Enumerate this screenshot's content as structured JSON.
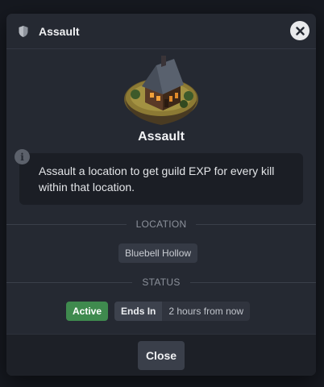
{
  "modal": {
    "header_title": "Assault",
    "header_icon": "shield-icon",
    "close_icon": "close-icon",
    "location_name": "Assault",
    "description": "Assault a location to get guild EXP for every kill within that location.",
    "info_icon": "info-icon",
    "info_glyph": "i",
    "location_section": "LOCATION",
    "location_value": "Bluebell Hollow",
    "status_section": "STATUS",
    "status_active": "Active",
    "ends_in_label": "Ends In",
    "ends_in_value": "2 hours from now",
    "close_button": "Close"
  },
  "colors": {
    "modal_bg": "#252932",
    "active_green": "#3f8a4e",
    "chip_bg": "#353a45"
  }
}
